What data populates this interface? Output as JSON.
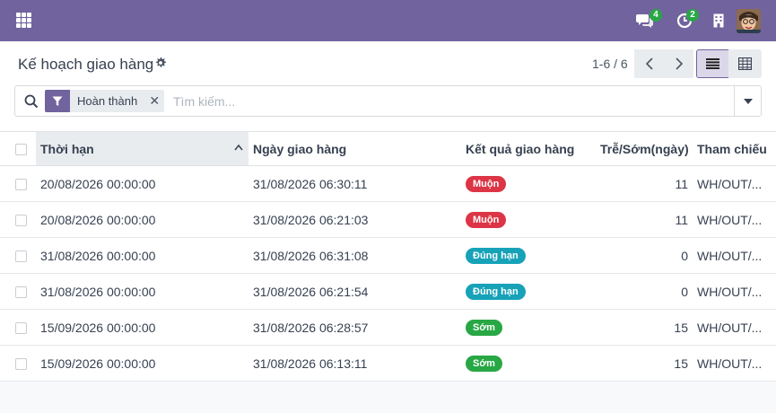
{
  "navbar": {
    "messages_count": "4",
    "activities_count": "2"
  },
  "control_panel": {
    "title": "Kế hoạch giao hàng",
    "pager": "1-6 / 6",
    "search": {
      "facet_label": "Hoàn thành",
      "placeholder": "Tìm kiếm..."
    }
  },
  "table": {
    "columns": [
      "Thời hạn",
      "Ngày giao hàng",
      "Kết quả giao hàng",
      "Trễ/Sớm(ngày)",
      "Tham chiếu"
    ],
    "rows": [
      {
        "deadline": "20/08/2026 00:00:00",
        "delivery_date": "31/08/2026 06:30:11",
        "result": "Muộn",
        "result_color": "#dc3545",
        "days": "11",
        "reference": "WH/OUT/..."
      },
      {
        "deadline": "20/08/2026 00:00:00",
        "delivery_date": "31/08/2026 06:21:03",
        "result": "Muộn",
        "result_color": "#dc3545",
        "days": "11",
        "reference": "WH/OUT/..."
      },
      {
        "deadline": "31/08/2026 00:00:00",
        "delivery_date": "31/08/2026 06:31:08",
        "result": "Đúng hạn",
        "result_color": "#17a2b8",
        "days": "0",
        "reference": "WH/OUT/..."
      },
      {
        "deadline": "31/08/2026 00:00:00",
        "delivery_date": "31/08/2026 06:21:54",
        "result": "Đúng hạn",
        "result_color": "#17a2b8",
        "days": "0",
        "reference": "WH/OUT/..."
      },
      {
        "deadline": "15/09/2026 00:00:00",
        "delivery_date": "31/08/2026 06:28:57",
        "result": "Sớm",
        "result_color": "#28a745",
        "days": "15",
        "reference": "WH/OUT/..."
      },
      {
        "deadline": "15/09/2026 00:00:00",
        "delivery_date": "31/08/2026 06:13:11",
        "result": "Sớm",
        "result_color": "#28a745",
        "days": "15",
        "reference": "WH/OUT/..."
      }
    ]
  },
  "colors": {
    "brand": "#71639e",
    "late": "#dc3545",
    "on_time": "#17a2b8",
    "early": "#28a745"
  }
}
